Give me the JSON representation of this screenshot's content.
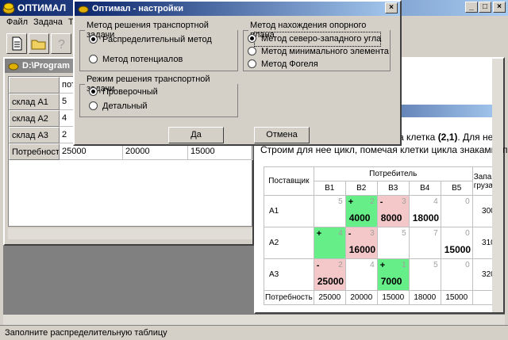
{
  "app": {
    "title": "ОПТИМАЛ",
    "menu": [
      "Файл",
      "Задача",
      "Т"
    ],
    "status": "Заполните распределительную таблицу"
  },
  "left_window": {
    "title": "D:\\Program",
    "header": [
      "",
      "пот"
    ],
    "rows": [
      {
        "label": "склад А1",
        "v1": "5",
        "v2": "",
        "v3": ""
      },
      {
        "label": "склад А2",
        "v1": "4",
        "v2": "",
        "v3": ""
      },
      {
        "label": "склад А3",
        "v1": "2",
        "v2": "",
        "v3": ""
      },
      {
        "label": "Потребности",
        "v1": "25000",
        "v2": "20000",
        "v3": "15000"
      }
    ]
  },
  "right_window": {
    "line1_a": "а клетка ",
    "line1_b": "(2,1)",
    "line1_c": ". Для нее",
    "line2": "Строим для нее цикл, помечая клетки цикла знаками \"п",
    "table": {
      "supplier_header": "Поставщик",
      "consumer_header": "Потребитель",
      "supply_header_1": "Запа",
      "supply_header_2": "груза",
      "cols": [
        "B1",
        "B2",
        "B3",
        "B4",
        "B5"
      ],
      "rows": [
        {
          "name": "A1",
          "supply": "300",
          "cells": [
            {
              "cost": "5",
              "sign": "",
              "amt": "",
              "color": ""
            },
            {
              "cost": "2",
              "sign": "+",
              "amt": "4000",
              "color": "green"
            },
            {
              "cost": "3",
              "sign": "-",
              "amt": "8000",
              "color": "pink"
            },
            {
              "cost": "4",
              "sign": "",
              "amt": "18000",
              "color": ""
            },
            {
              "cost": "0",
              "sign": "",
              "amt": "",
              "color": ""
            }
          ]
        },
        {
          "name": "A2",
          "supply": "310",
          "cells": [
            {
              "cost": "4",
              "sign": "+",
              "amt": "",
              "color": "green"
            },
            {
              "cost": "3",
              "sign": "-",
              "amt": "16000",
              "color": "pink"
            },
            {
              "cost": "5",
              "sign": "",
              "amt": "",
              "color": ""
            },
            {
              "cost": "7",
              "sign": "",
              "amt": "",
              "color": ""
            },
            {
              "cost": "0",
              "sign": "",
              "amt": "15000",
              "color": ""
            }
          ]
        },
        {
          "name": "A3",
          "supply": "320",
          "cells": [
            {
              "cost": "2",
              "sign": "-",
              "amt": "25000",
              "color": "pink"
            },
            {
              "cost": "4",
              "sign": "",
              "amt": "",
              "color": ""
            },
            {
              "cost": "1",
              "sign": "+",
              "amt": "7000",
              "color": "green"
            },
            {
              "cost": "5",
              "sign": "",
              "amt": "",
              "color": ""
            },
            {
              "cost": "0",
              "sign": "",
              "amt": "",
              "color": ""
            }
          ]
        }
      ],
      "need_label": "Потребность",
      "needs": [
        "25000",
        "20000",
        "15000",
        "18000",
        "15000"
      ]
    }
  },
  "dialog": {
    "title": "Оптимал - настройки",
    "group_method": "Метод решения транспортной задачи",
    "method_options": [
      "Распределительный метод",
      "Метод потенциалов"
    ],
    "group_mode": "Режим решения транспортной задачи",
    "mode_options": [
      "Проверочный",
      "Детальный"
    ],
    "group_plan": "Метод нахождения опорного плана",
    "plan_options": [
      "Метод северо-западного угла",
      "Метод минимального элемента",
      "Метод Фогеля"
    ],
    "ok": "Да",
    "cancel": "Отмена"
  }
}
